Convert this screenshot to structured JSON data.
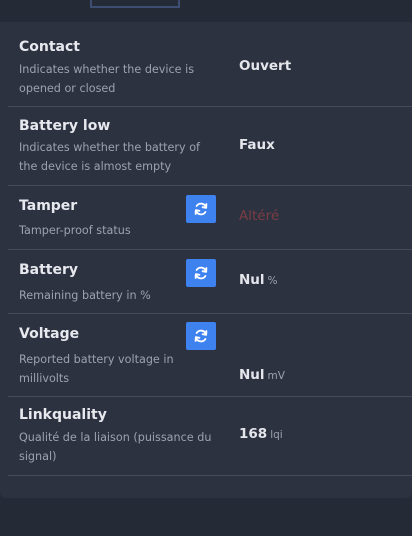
{
  "rows": [
    {
      "label": "Contact",
      "desc": "Indicates whether the device is opened or closed",
      "value": "Ouvert",
      "unit": ""
    },
    {
      "label": "Battery low",
      "desc": "Indicates whether the battery of the device is almost empty",
      "value": "Faux",
      "unit": ""
    },
    {
      "label": "Tamper",
      "desc": "Tamper-proof status",
      "value": "Altéré",
      "unit": ""
    },
    {
      "label": "Battery",
      "desc": "Remaining battery in %",
      "value": "Nul",
      "unit": "%"
    },
    {
      "label": "Voltage",
      "desc": "Reported battery voltage in millivolts",
      "value": "Nul",
      "unit": "mV"
    },
    {
      "label": "Linkquality",
      "desc": "Qualité de la liaison (puissance du signal)",
      "value": "168",
      "unit": "lqi"
    }
  ],
  "colors": {
    "background": "#252a37",
    "panel": "#2d3241",
    "accent": "#3e82f0",
    "tampered": "#7a3d44"
  },
  "icons": {
    "refresh": "refresh-icon"
  }
}
